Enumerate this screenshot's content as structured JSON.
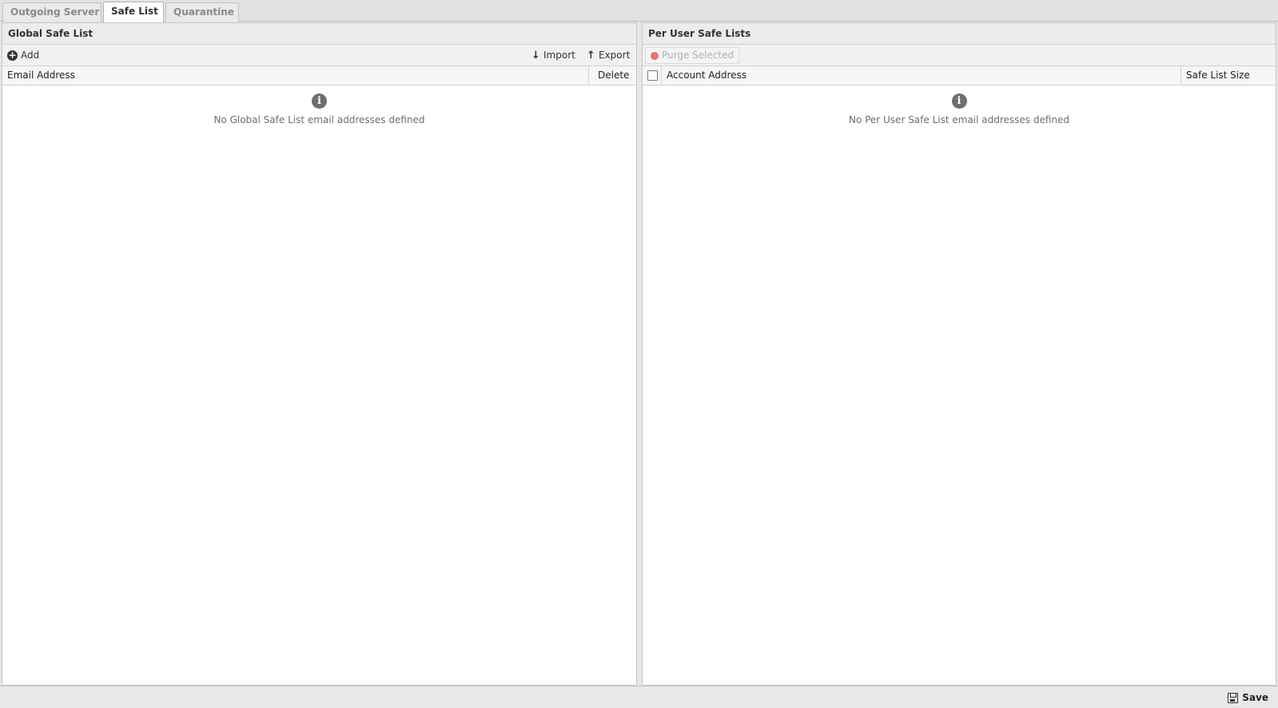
{
  "tabs": [
    {
      "label": "Outgoing Server",
      "active": false
    },
    {
      "label": "Safe List",
      "active": true
    },
    {
      "label": "Quarantine",
      "active": false
    }
  ],
  "global": {
    "title": "Global Safe List",
    "toolbar": {
      "add_label": "Add",
      "import_label": "Import",
      "export_label": "Export"
    },
    "columns": {
      "email": "Email Address",
      "delete": "Delete"
    },
    "empty_message": "No Global Safe List email addresses defined"
  },
  "per_user": {
    "title": "Per User Safe Lists",
    "toolbar": {
      "purge_label": "Purge Selected"
    },
    "columns": {
      "account": "Account Address",
      "size": "Safe List Size"
    },
    "empty_message": "No Per User Safe List email addresses defined"
  },
  "footer": {
    "save_label": "Save"
  },
  "icons": {
    "add": "add-circle-icon",
    "import": "arrow-down-icon",
    "export": "arrow-up-icon",
    "purge": "red-dot-icon",
    "info": "info-icon",
    "save": "floppy-disk-icon"
  },
  "colors": {
    "purge_dot": "#e57373",
    "info_icon": "#6f6f6f"
  }
}
